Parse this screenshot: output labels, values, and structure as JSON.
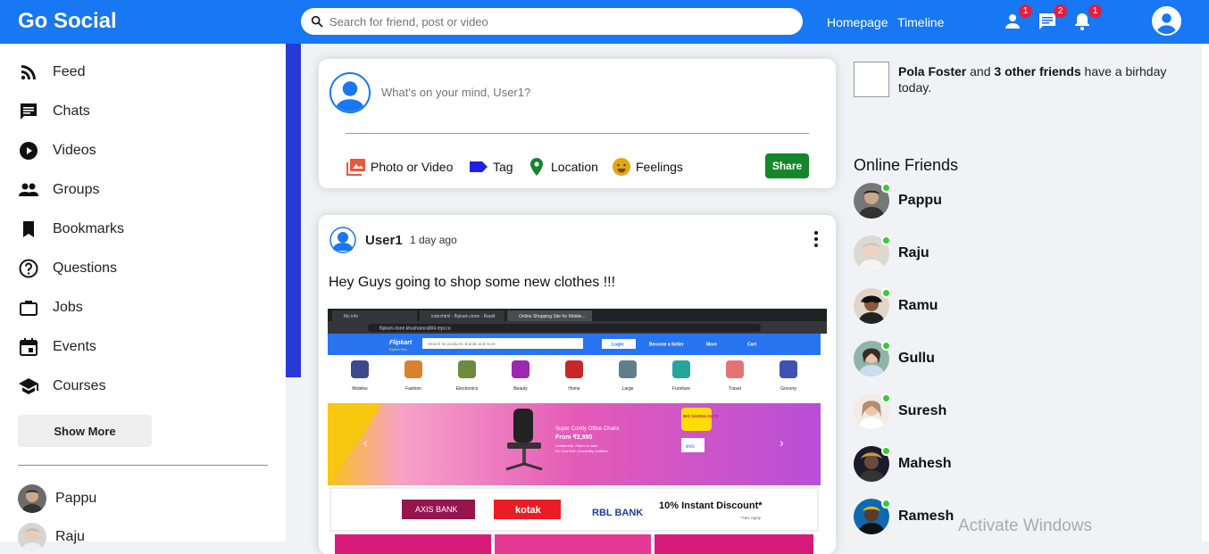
{
  "header": {
    "logo": "Go Social",
    "search_placeholder": "Search for friend, post or video",
    "links": [
      "Homepage",
      "Timeline"
    ],
    "badges": {
      "friends": "1",
      "messages": "2",
      "notifications": "1"
    },
    "brand_color": "#1877f2"
  },
  "sidebar": {
    "items": [
      {
        "label": "Feed",
        "icon": "rss-feed-icon"
      },
      {
        "label": "Chats",
        "icon": "chat-icon"
      },
      {
        "label": "Videos",
        "icon": "play-circle-icon"
      },
      {
        "label": "Groups",
        "icon": "group-icon"
      },
      {
        "label": "Bookmarks",
        "icon": "bookmark-icon"
      },
      {
        "label": "Questions",
        "icon": "help-circle-icon"
      },
      {
        "label": "Jobs",
        "icon": "briefcase-icon"
      },
      {
        "label": "Events",
        "icon": "calendar-icon"
      },
      {
        "label": "Courses",
        "icon": "school-icon"
      }
    ],
    "show_more": "Show More",
    "friends": [
      "Pappu",
      "Raju"
    ]
  },
  "share": {
    "placeholder": "What's on your mind, User1?",
    "options": [
      {
        "label": "Photo or Video",
        "icon": "photo-library-icon",
        "color": "#e9573f"
      },
      {
        "label": "Tag",
        "icon": "label-icon",
        "color": "#1f22e0"
      },
      {
        "label": "Location",
        "icon": "location-pin-icon",
        "color": "#15862a"
      },
      {
        "label": "Feelings",
        "icon": "emoji-icon",
        "color": "#e3a71a"
      }
    ],
    "button": "Share"
  },
  "post": {
    "user": "User1",
    "time": "1 day ago",
    "text": "Hey Guys going to shop some new clothes !!!",
    "screenshot": {
      "tabs": [
        "My info",
        "indexhtml - flipkart-clone - Replit",
        "Online Shopping Site for Mobile..."
      ],
      "url": "flipkart-clone.khusharora004.repl.co",
      "brand": "Flipkart",
      "brand_sub": "Explore Plus",
      "search": "Search for products, brands and more",
      "login": "Login",
      "become_seller": "Become a Seller",
      "more": "More",
      "cart": "Cart",
      "categories": [
        "Mobiles",
        "Fashion",
        "Electronics",
        "Beauty",
        "Home",
        "Large",
        "Furniture",
        "Travel",
        "Grocery"
      ],
      "banner_title": "Super Comfy Office Chairs",
      "banner_price": "From ₹2,990",
      "banner_line1": "Leatherette, Fabric & more",
      "banner_line2": "No Cost EMI | Durability Certified",
      "banner_badge": "BIG SAVING DAYS",
      "banner_evo": "evo",
      "banks": [
        "AXIS BANK",
        "kotak",
        "RBL BANK"
      ],
      "offer": "10% Instant Discount*",
      "offer_note": "*T&C Apply"
    }
  },
  "right": {
    "birthday_name": "Pola Foster",
    "birthday_and": "and",
    "birthday_count": "3 other friends",
    "birthday_rest": "have a birhday today.",
    "online_title": "Online Friends",
    "online": [
      "Pappu",
      "Raju",
      "Ramu",
      "Gullu",
      "Suresh",
      "Mahesh",
      "Ramesh"
    ]
  },
  "watermark": "Activate Windows"
}
